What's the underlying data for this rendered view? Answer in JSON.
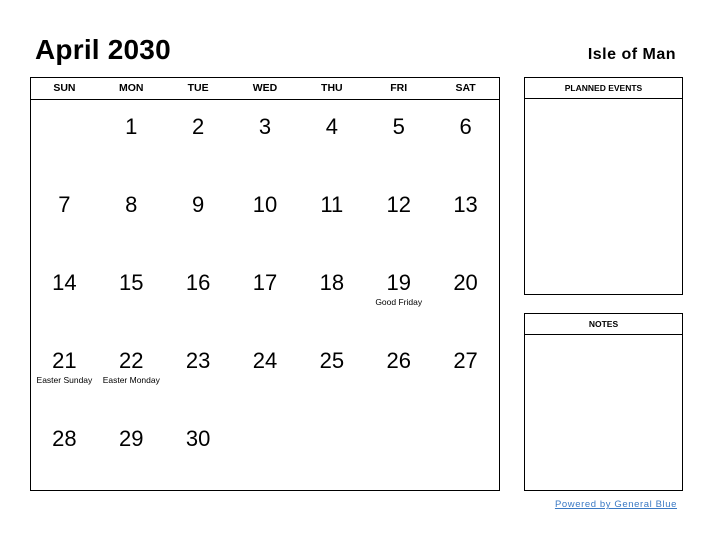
{
  "header": {
    "title": "April 2030",
    "region": "Isle of Man"
  },
  "calendar": {
    "weekdays": [
      "SUN",
      "MON",
      "TUE",
      "WED",
      "THU",
      "FRI",
      "SAT"
    ],
    "weeks": [
      [
        {
          "day": ""
        },
        {
          "day": "1"
        },
        {
          "day": "2"
        },
        {
          "day": "3"
        },
        {
          "day": "4"
        },
        {
          "day": "5"
        },
        {
          "day": "6"
        }
      ],
      [
        {
          "day": "7"
        },
        {
          "day": "8"
        },
        {
          "day": "9"
        },
        {
          "day": "10"
        },
        {
          "day": "11"
        },
        {
          "day": "12"
        },
        {
          "day": "13"
        }
      ],
      [
        {
          "day": "14"
        },
        {
          "day": "15"
        },
        {
          "day": "16"
        },
        {
          "day": "17"
        },
        {
          "day": "18"
        },
        {
          "day": "19",
          "holiday": "Good Friday"
        },
        {
          "day": "20"
        }
      ],
      [
        {
          "day": "21",
          "holiday": "Easter Sunday"
        },
        {
          "day": "22",
          "holiday": "Easter Monday"
        },
        {
          "day": "23"
        },
        {
          "day": "24"
        },
        {
          "day": "25"
        },
        {
          "day": "26"
        },
        {
          "day": "27"
        }
      ],
      [
        {
          "day": "28"
        },
        {
          "day": "29"
        },
        {
          "day": "30"
        },
        {
          "day": ""
        },
        {
          "day": ""
        },
        {
          "day": ""
        },
        {
          "day": ""
        }
      ]
    ]
  },
  "panels": {
    "planned_events": "PLANNED EVENTS",
    "notes": "NOTES"
  },
  "footer": {
    "powered_by": "Powered by General Blue",
    "link_color": "#3a79c4"
  }
}
